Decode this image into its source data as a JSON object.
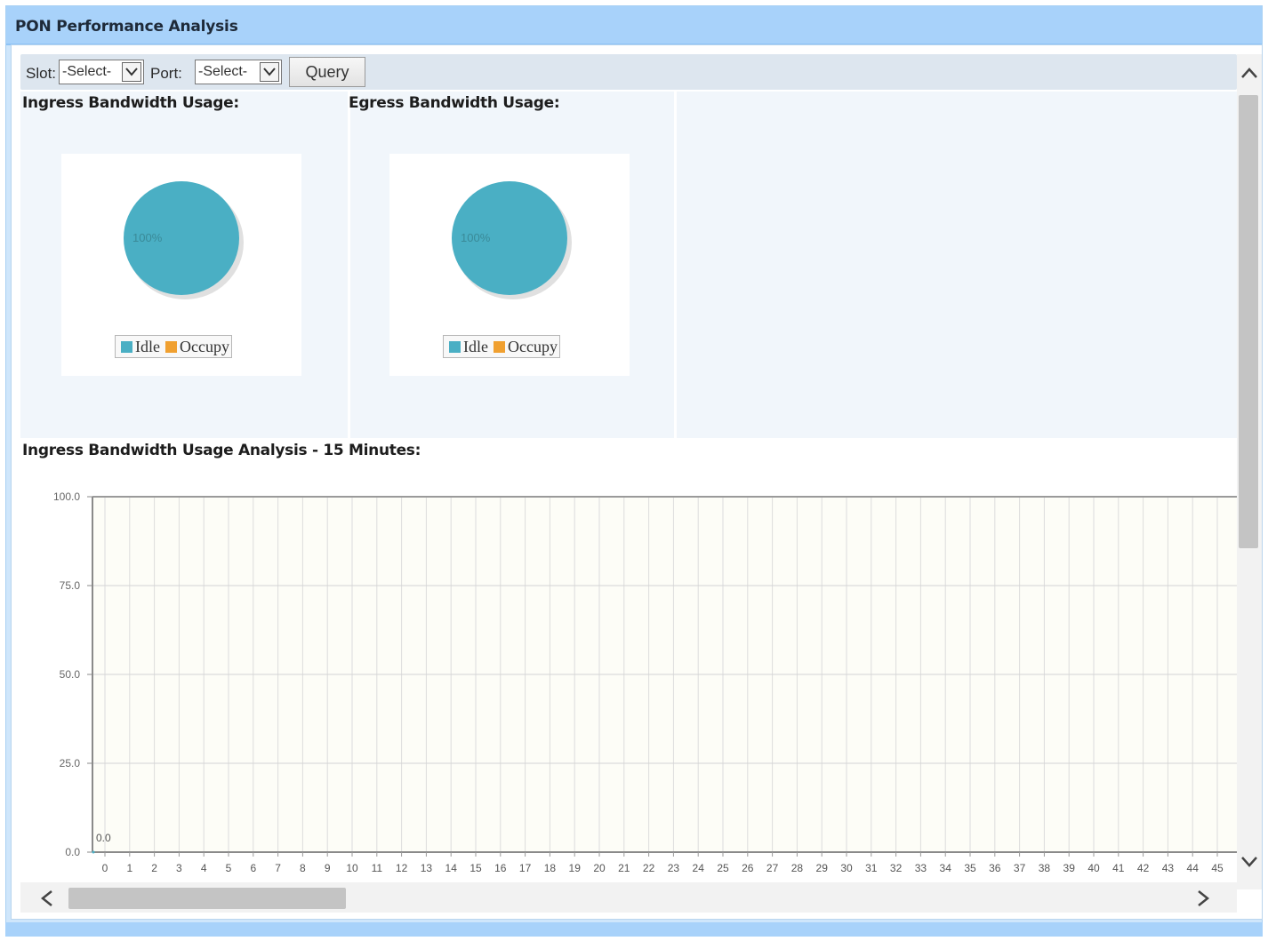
{
  "window": {
    "title": "PON Performance Analysis"
  },
  "toolbar": {
    "slot_label": "Slot:",
    "slot_value": "-Select-",
    "port_label": "Port:",
    "port_value": "-Select-",
    "query_label": "Query"
  },
  "ingress": {
    "title": "Ingress Bandwidth Usage:",
    "chart_data": {
      "type": "pie",
      "slices": [
        {
          "name": "Idle",
          "value": 100
        },
        {
          "name": "Occupy",
          "value": 0
        }
      ],
      "slice_label": "100%"
    }
  },
  "egress": {
    "title": "Egress Bandwidth Usage:",
    "chart_data": {
      "type": "pie",
      "slices": [
        {
          "name": "Idle",
          "value": 100
        },
        {
          "name": "Occupy",
          "value": 0
        }
      ],
      "slice_label": "100%"
    }
  },
  "legend": {
    "idle": "Idle",
    "occupy": "Occupy",
    "idle_color": "#4aafc4",
    "occupy_color": "#f0a030"
  },
  "analysis": {
    "title": "Ingress Bandwidth Usage Analysis - 15 Minutes:",
    "chart_data": {
      "type": "line",
      "x": [
        0,
        1,
        2,
        3,
        4,
        5,
        6,
        7,
        8,
        9,
        10,
        11,
        12,
        13,
        14,
        15,
        16,
        17,
        18,
        19,
        20,
        21,
        22,
        23,
        24,
        25,
        26,
        27,
        28,
        29,
        30,
        31,
        32,
        33,
        34,
        35,
        36,
        37,
        38,
        39,
        40,
        41,
        42,
        43,
        44,
        45
      ],
      "ylim": [
        0,
        100
      ],
      "yticks": [
        "100.0",
        "75.0",
        "50.0",
        "25.0",
        "0.0"
      ],
      "series": [
        {
          "values": [
            0
          ]
        }
      ],
      "point_label": "0.0",
      "grid": true
    }
  },
  "colors": {
    "title_bar": "#a8d2fa",
    "pie_fill": "#4aafc4",
    "plot_bg": "#fdfdf7"
  }
}
